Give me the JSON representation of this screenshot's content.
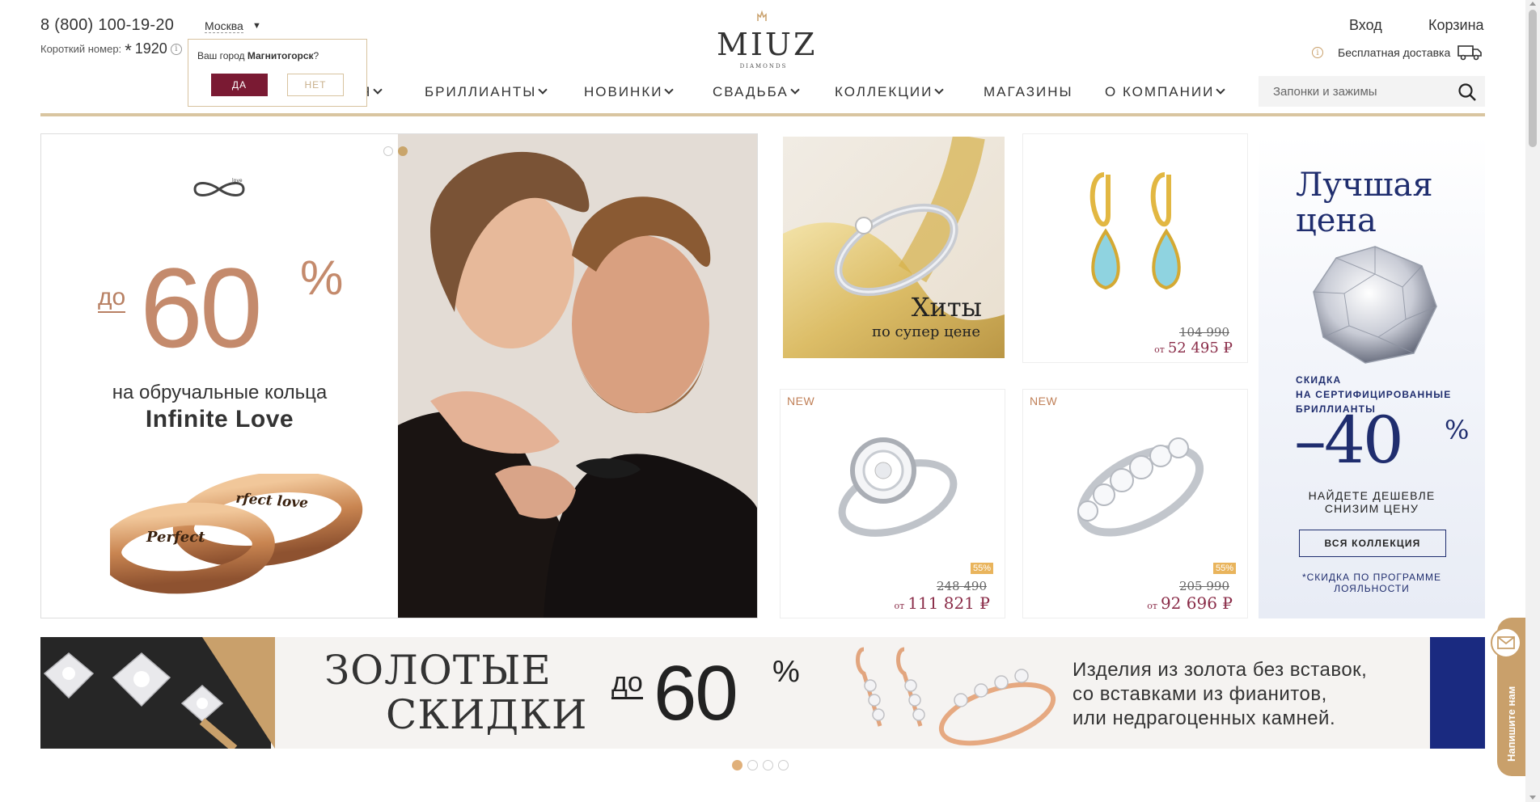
{
  "header": {
    "phone": "8 (800) 100-19-20",
    "short_label": "Короткий номер:",
    "short_star": "*",
    "short_number": "1920",
    "info_glyph": "i",
    "city": "Москва",
    "city_caret": "▼",
    "login": "Вход",
    "cart": "Корзина",
    "delivery": "Бесплатная доставка",
    "logo": "MIUZ",
    "logo_sub": "DIAMONDS"
  },
  "city_popup": {
    "question_prefix": "Ваш город",
    "city": "Магнитогорск",
    "question_suffix": "?",
    "yes": "ДА",
    "no": "НЕТ"
  },
  "nav": {
    "items": [
      {
        "label": "Я",
        "chevron": true
      },
      {
        "label": "БРИЛЛИАНТЫ",
        "chevron": true
      },
      {
        "label": "НОВИНКИ",
        "chevron": true
      },
      {
        "label": "СВАДЬБА",
        "chevron": true
      },
      {
        "label": "КОЛЛЕКЦИИ",
        "chevron": true
      },
      {
        "label": "МАГАЗИНЫ",
        "chevron": false
      },
      {
        "label": "О КОМПАНИИ",
        "chevron": true
      }
    ]
  },
  "search": {
    "placeholder": "Запонки и зажимы"
  },
  "hero": {
    "do": "до",
    "value": "60",
    "pct": "%",
    "line1": "на обручальные кольца",
    "line2": "Infinite Love",
    "ring1_text": "Perfect",
    "ring2_text": "rfect love",
    "logo_text": "love",
    "slides_total": 2,
    "active_slide": 2
  },
  "tiles": {
    "hits": {
      "title": "Хиты",
      "subtitle": "по супер цене"
    },
    "earrings": {
      "old_price": "104 990",
      "from": "от",
      "price": "52 495 ₽"
    },
    "ring1": {
      "new": "NEW",
      "badge": "55%",
      "old_price": "248 490",
      "from": "от",
      "price": "111 821 ₽"
    },
    "ring2": {
      "new": "NEW",
      "badge": "55%",
      "old_price": "205 990",
      "from": "от",
      "price": "92 696 ₽"
    }
  },
  "best_price": {
    "title_line1": "Лучшая",
    "title_line2": "цена",
    "discount_line1": "СКИДКА",
    "discount_line2": "НА СЕРТИФИЦИРОВАННЫЕ",
    "discount_line3": "БРИЛЛИАНТЫ",
    "value": "–40",
    "pct": "%",
    "find_line1": "НАЙДЕТЕ ДЕШЕВЛЕ",
    "find_line2": "СНИЗИМ ЦЕНУ",
    "button": "ВСЯ КОЛЛЕКЦИЯ",
    "note_line1": "*СКИДКА ПО ПРОГРАММЕ",
    "note_line2": "ЛОЯЛЬНОСТИ"
  },
  "banner": {
    "title_line1": "ЗОЛОТЫЕ",
    "title_line2": "СКИДКИ",
    "do": "до",
    "value": "60",
    "pct": "%",
    "desc_line1": "Изделия из золота без вставок,",
    "desc_line2": "со вставками из фианитов,",
    "desc_line3": "или недрагоценных камней.",
    "slides_total": 4,
    "active_slide": 1
  },
  "chat": {
    "label": "Напишите нам"
  },
  "colors": {
    "gold": "#d9c5a0",
    "burgundy": "#7a1a33",
    "price": "#8a2c48",
    "navy": "#1f2d6e",
    "hero_copper": "#c48a6c"
  }
}
